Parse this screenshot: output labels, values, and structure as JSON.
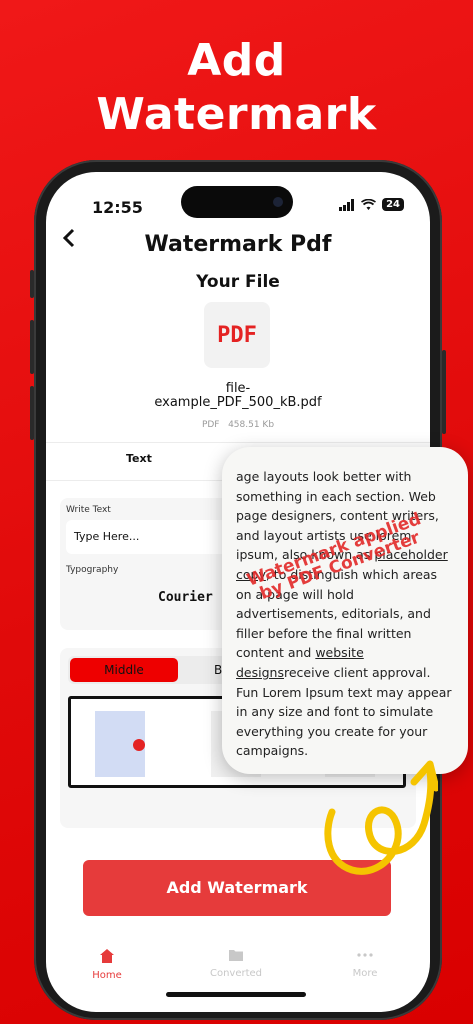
{
  "hero": {
    "line1": "Add",
    "line2": "Watermark"
  },
  "status_bar": {
    "time": "12:55",
    "battery": "24"
  },
  "header": {
    "title": "Watermark Pdf"
  },
  "file_section": {
    "heading": "Your File",
    "thumb_label": "PDF",
    "file_name_line1": "file-",
    "file_name_line2": "example_PDF_500_kB.pdf",
    "file_type": "PDF",
    "file_size": "458.51 Kb"
  },
  "tabs": {
    "text": "Text"
  },
  "text_settings": {
    "write_label": "Write Text",
    "input_placeholder": "Type Here...",
    "typography_label": "Typography",
    "typography_value": "Courier"
  },
  "position": {
    "middle": "Middle",
    "b": "B"
  },
  "cta": {
    "label": "Add Watermark"
  },
  "tabbar": {
    "home": "Home",
    "converted": "Converted",
    "more": "More"
  },
  "preview_bubble": {
    "p1": "age layouts look better with something in each section. Web page designers, content writers, and layout artists use lorem ipsum, also known as ",
    "link1": "placeholder copy",
    "p2": ", to distinguish which areas on a page will hold advertisements, editorials, and filler before the final written content and ",
    "link2": "website designs",
    "p3": "receive client approval. Fun Lorem Ipsum text may appear in any size and font to simulate everything you create for your campaigns.",
    "watermark_line1": "Watermark applied",
    "watermark_line2": "by PDF Converter"
  },
  "colors": {
    "brand_red": "#e00a0a",
    "cta_red": "#e63b3b",
    "accent": "#f5c400"
  }
}
